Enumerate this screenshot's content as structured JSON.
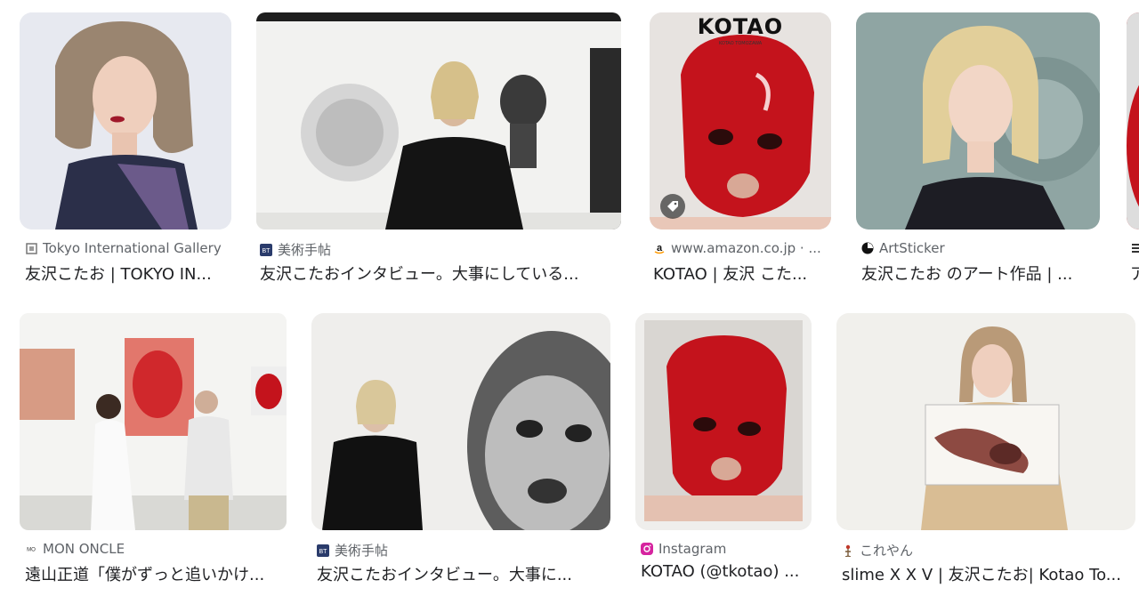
{
  "results": [
    {
      "source": "Tokyo International Gallery",
      "favicon": "gallery-icon",
      "title": "友沢こたお | TOKYO IN..."
    },
    {
      "source": "美術手帖",
      "favicon": "bt-icon",
      "title": "友沢こたおインタビュー。大事にしている..."
    },
    {
      "source": "www.amazon.co.jp · ...",
      "favicon": "amazon-icon",
      "title": "KOTAO | 友沢 こた...",
      "cover_text": "KOTAO",
      "cover_subtext": "KOTAO TOMOZAWA"
    },
    {
      "source": "ArtSticker",
      "favicon": "artsticker-icon",
      "title": "友沢こたお のアート作品 | ..."
    },
    {
      "source": "",
      "favicon": "tokyo-icon",
      "title": "ア"
    },
    {
      "source": "MON ONCLE",
      "favicon": "mononcle-icon",
      "title": "遠山正道「僕がずっと追いかけ..."
    },
    {
      "source": "美術手帖",
      "favicon": "bt-icon",
      "title": "友沢こたおインタビュー。大事に..."
    },
    {
      "source": "Instagram",
      "favicon": "instagram-icon",
      "title": "KOTAO (@tkotao) ..."
    },
    {
      "source": "これやん",
      "favicon": "koreyan-icon",
      "title": "slime X X V | 友沢こたお| Kotao To..."
    }
  ],
  "colors": {
    "red_art": "#c4131c",
    "text": "#202124",
    "meta": "#5f6368",
    "instagram": "#d6249f",
    "bt": "#2a3b6b"
  }
}
